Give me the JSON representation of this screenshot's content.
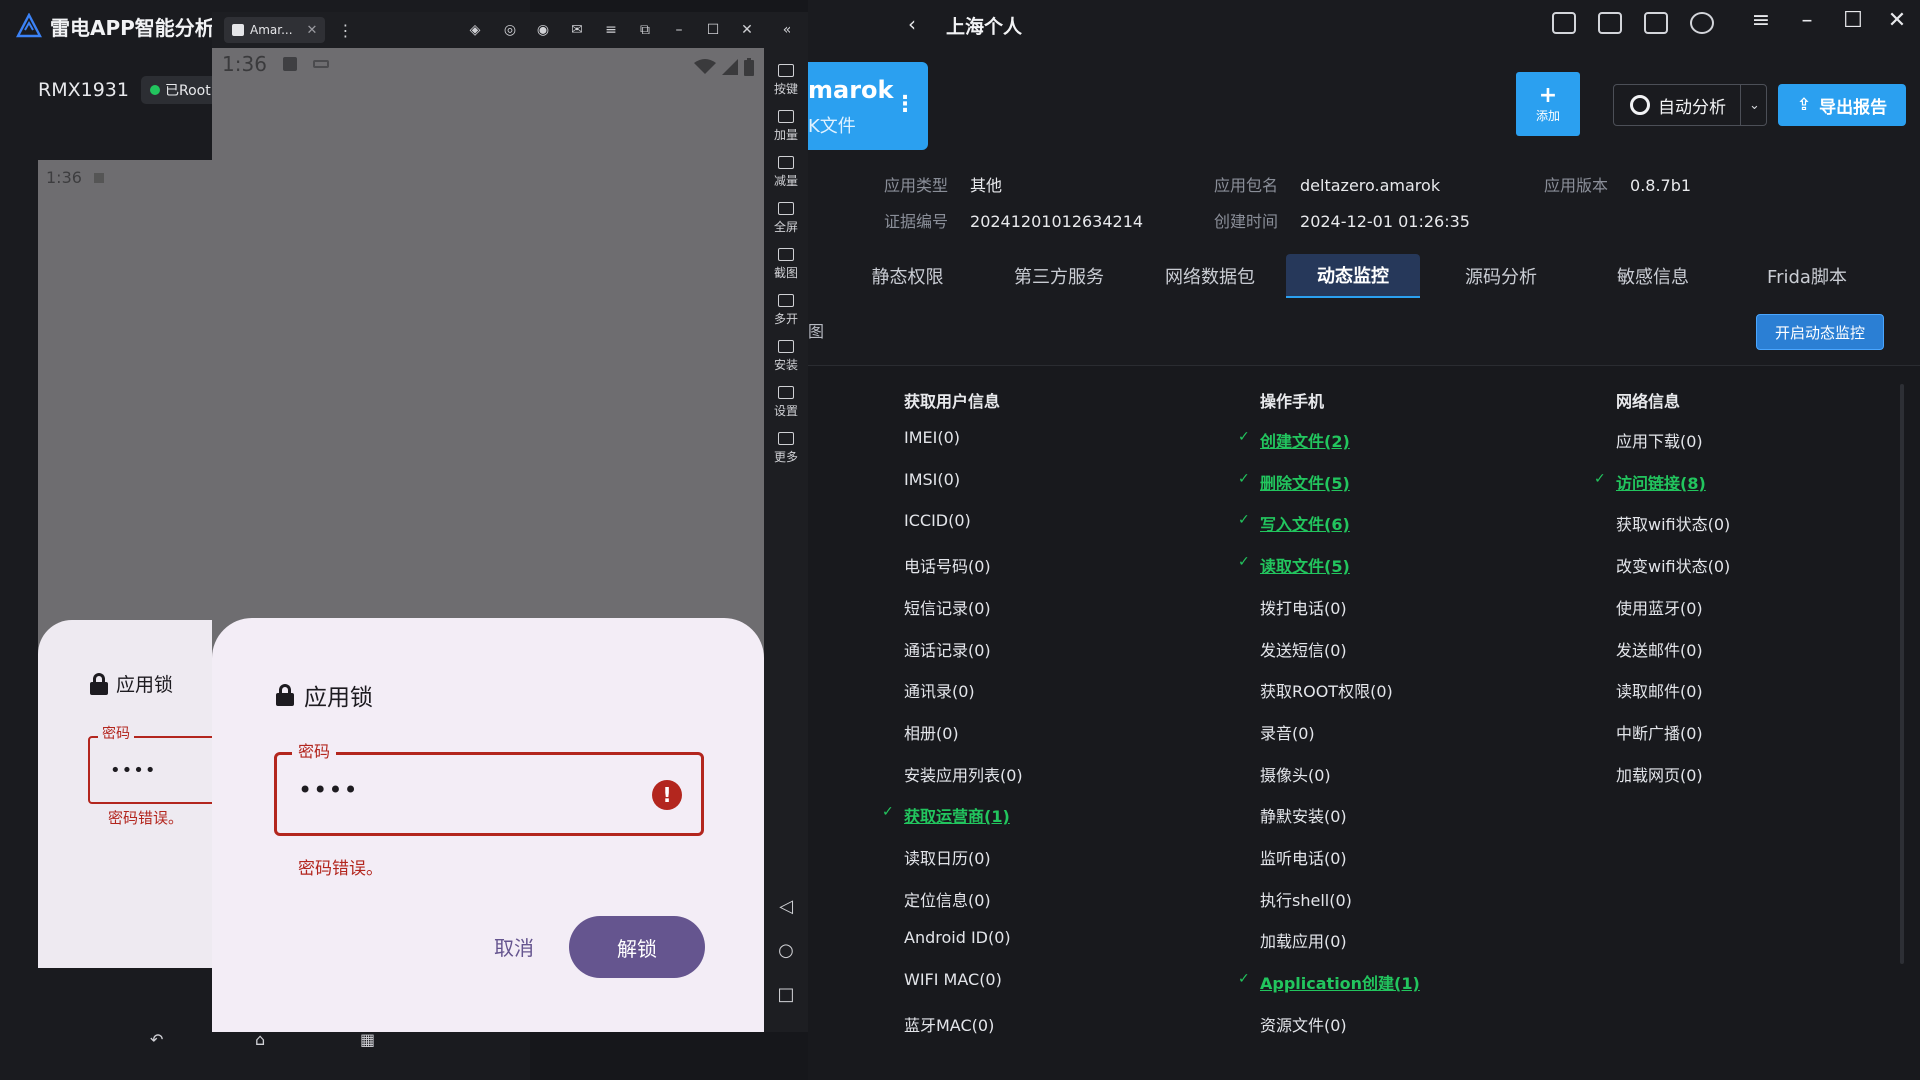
{
  "brand": {
    "title": "雷电APP智能分析"
  },
  "device": {
    "name": "RMX1931",
    "root_badge": "已Root"
  },
  "mini_phone": {
    "time": "1:36",
    "dialog_title": "应用锁",
    "password_label": "密码",
    "password_mask": "••••",
    "error_text": "密码错误。"
  },
  "emulator": {
    "tab_label": "Amar...",
    "phone": {
      "time": "1:36",
      "dialog": {
        "title": "应用锁",
        "password_label": "密码",
        "password_mask": "••••",
        "error_text": "密码错误。",
        "cancel_label": "取消",
        "unlock_label": "解锁"
      }
    },
    "tools": [
      "按键",
      "加量",
      "减量",
      "全屏",
      "截图",
      "多开",
      "安装",
      "设置",
      "更多"
    ]
  },
  "header": {
    "title": "上海个人"
  },
  "app_card": {
    "name": "marok",
    "subtitle": "K文件"
  },
  "actions": {
    "add_label": "添加",
    "auto_label": "自动分析",
    "export_label": "导出报告",
    "monitor_label": "开启动态监控"
  },
  "meta": {
    "app_type_k": "应用类型",
    "app_type_v": "其他",
    "package_k": "应用包名",
    "package_v": "deltazero.amarok",
    "version_k": "应用版本",
    "version_v": "0.8.7b1",
    "cert_k": "证据编号",
    "cert_v": "20241201012634214",
    "created_k": "创建时间",
    "created_v": "2024-12-01 01:26:35"
  },
  "tabs": [
    "静态权限",
    "第三方服务",
    "网络数据包",
    "动态监控",
    "源码分析",
    "敏感信息",
    "Frida脚本"
  ],
  "sub_label": "图",
  "columns": [
    {
      "header": "获取用户信息",
      "items": [
        {
          "label": "IMEI(0)",
          "on": false
        },
        {
          "label": "IMSI(0)",
          "on": false
        },
        {
          "label": "ICCID(0)",
          "on": false
        },
        {
          "label": "电话号码(0)",
          "on": false
        },
        {
          "label": "短信记录(0)",
          "on": false
        },
        {
          "label": "通话记录(0)",
          "on": false
        },
        {
          "label": "通讯录(0)",
          "on": false
        },
        {
          "label": "相册(0)",
          "on": false
        },
        {
          "label": "安装应用列表(0)",
          "on": false
        },
        {
          "label": "获取运营商(1)",
          "on": true
        },
        {
          "label": "读取日历(0)",
          "on": false
        },
        {
          "label": "定位信息(0)",
          "on": false
        },
        {
          "label": "Android ID(0)",
          "on": false
        },
        {
          "label": "WIFI MAC(0)",
          "on": false
        },
        {
          "label": "蓝牙MAC(0)",
          "on": false
        }
      ]
    },
    {
      "header": "操作手机",
      "items": [
        {
          "label": "创建文件(2)",
          "on": true
        },
        {
          "label": "删除文件(5)",
          "on": true
        },
        {
          "label": "写入文件(6)",
          "on": true
        },
        {
          "label": "读取文件(5)",
          "on": true
        },
        {
          "label": "拨打电话(0)",
          "on": false
        },
        {
          "label": "发送短信(0)",
          "on": false
        },
        {
          "label": "获取ROOT权限(0)",
          "on": false
        },
        {
          "label": "录音(0)",
          "on": false
        },
        {
          "label": "摄像头(0)",
          "on": false
        },
        {
          "label": "静默安装(0)",
          "on": false
        },
        {
          "label": "监听电话(0)",
          "on": false
        },
        {
          "label": "执行shell(0)",
          "on": false
        },
        {
          "label": "加载应用(0)",
          "on": false
        },
        {
          "label": "Application创建(1)",
          "on": true
        },
        {
          "label": "资源文件(0)",
          "on": false
        }
      ]
    },
    {
      "header": "网络信息",
      "items": [
        {
          "label": "应用下载(0)",
          "on": false
        },
        {
          "label": "访问链接(8)",
          "on": true
        },
        {
          "label": "获取wifi状态(0)",
          "on": false
        },
        {
          "label": "改变wifi状态(0)",
          "on": false
        },
        {
          "label": "使用蓝牙(0)",
          "on": false
        },
        {
          "label": "发送邮件(0)",
          "on": false
        },
        {
          "label": "读取邮件(0)",
          "on": false
        },
        {
          "label": "中断广播(0)",
          "on": false
        },
        {
          "label": "加载网页(0)",
          "on": false
        }
      ]
    }
  ],
  "colors": {
    "accent": "#2ba0f0",
    "success": "#22c55e",
    "error": "#b3261e",
    "primary_m3": "#65558f"
  }
}
